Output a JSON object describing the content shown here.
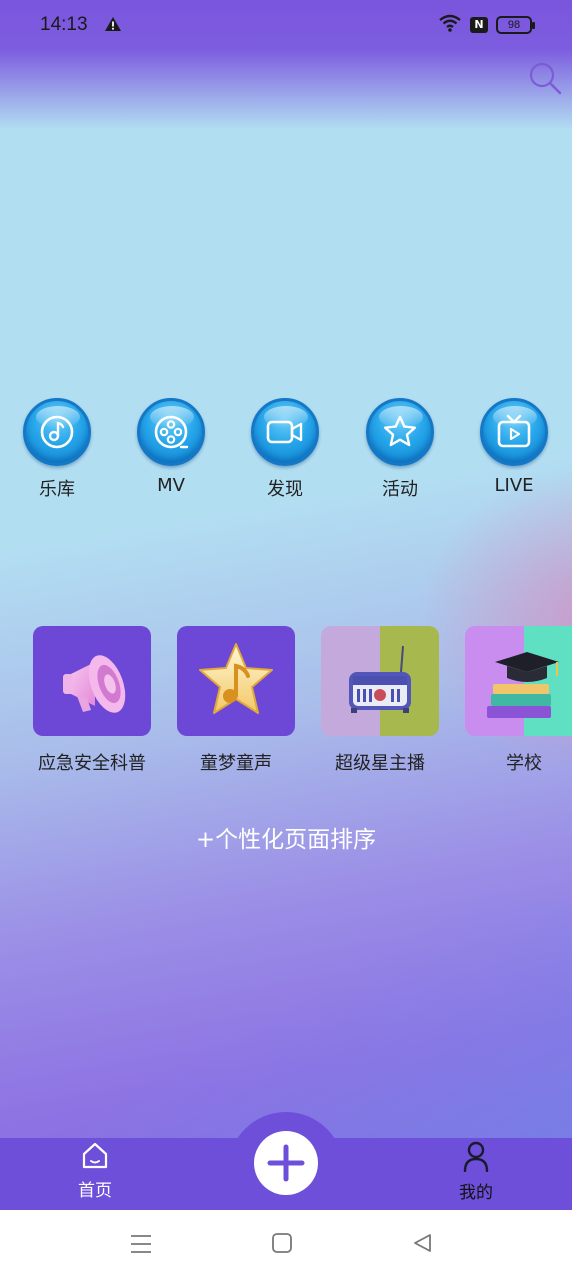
{
  "status_bar": {
    "time": "14:13",
    "battery": "98",
    "nfc": "N"
  },
  "search": {
    "icon": "search-icon"
  },
  "quick_nav": [
    {
      "label": "乐库",
      "icon": "music-note-icon"
    },
    {
      "label": "MV",
      "icon": "film-reel-icon"
    },
    {
      "label": "发现",
      "icon": "video-camera-icon"
    },
    {
      "label": "活动",
      "icon": "star-icon"
    },
    {
      "label": "LIVE",
      "icon": "tv-play-icon"
    }
  ],
  "features": [
    {
      "label": "应急安全科普",
      "icon": "megaphone-icon"
    },
    {
      "label": "童梦童声",
      "icon": "star-music-icon"
    },
    {
      "label": "超级星主播",
      "icon": "radio-icon"
    },
    {
      "label": "学校",
      "icon": "graduation-books-icon"
    }
  ],
  "sort_link": "+个性化页面排序",
  "bottom_nav": {
    "home_label": "首页",
    "mine_label": "我的"
  },
  "colors": {
    "accent": "#6e4fd9",
    "icon_blue": "#27a6ea",
    "tile_purple": "#6d48d6"
  }
}
